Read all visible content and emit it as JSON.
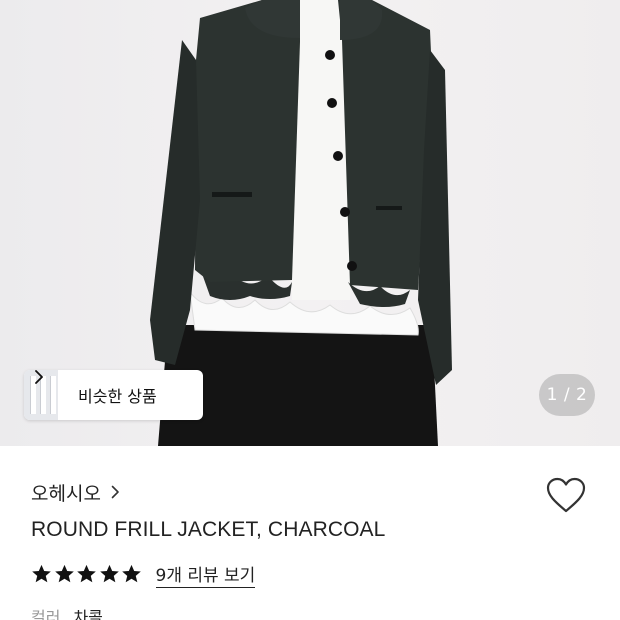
{
  "hero": {
    "similar_button_label": "비슷한 상품",
    "image_counter": "1 / 2"
  },
  "product": {
    "brand": "오헤시오",
    "title": "ROUND FRILL JACKET, CHARCOAL",
    "rating_stars": 5,
    "review_link": "9개 리뷰 보기",
    "color_label": "컬러",
    "color_value": "차콜"
  },
  "icons": {
    "similar_chevron": "chevron-right-icon",
    "brand_chevron": "chevron-right-icon",
    "wishlist": "heart-outline-icon",
    "rating": "star-icon"
  },
  "colors": {
    "star": "#111111",
    "text_primary": "#222222",
    "text_secondary": "#999999",
    "counter_bg": "#aaaaaa"
  }
}
